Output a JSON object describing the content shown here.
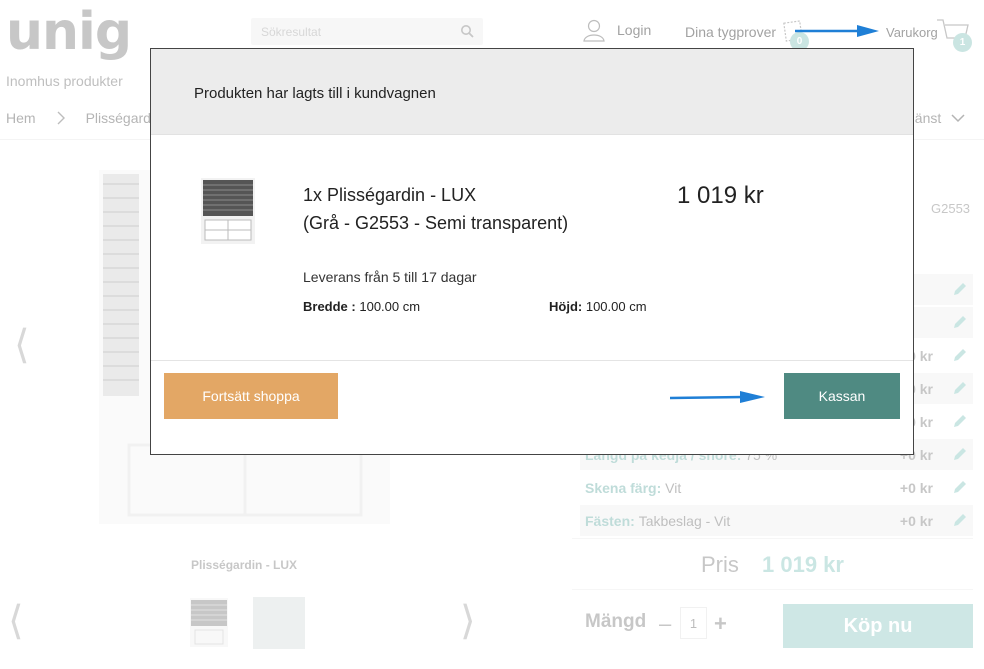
{
  "colors": {
    "accent": "#9fd2cd",
    "checkout": "#4f8a82",
    "continue": "#e3a765",
    "annotation_arrow": "#1f7fd6"
  },
  "header": {
    "logo": "unig",
    "search_placeholder": "Sökresultat",
    "login_label": "Login",
    "swatches_label": "Dina tygprover",
    "swatches_count": "0",
    "cart_label": "Varukorg",
    "cart_count": "1"
  },
  "subnav": {
    "label": "Inomhus produkter"
  },
  "breadcrumb": {
    "home": "Hem",
    "current": "Plisségardin",
    "right_menu": "dtjänst"
  },
  "product": {
    "caption": "Plisségardin - LUX",
    "code": "G2553"
  },
  "options": [
    {
      "label": "",
      "value": "",
      "price": ""
    },
    {
      "label": "",
      "value": "",
      "price": ""
    },
    {
      "label": "",
      "value": "",
      "price": "0 kr"
    },
    {
      "label": "",
      "value": "",
      "price": "0 kr"
    },
    {
      "label": "",
      "value": "",
      "price": "0 kr"
    },
    {
      "label": "Längd på kedja / snöre:",
      "value": "75 %",
      "price": "+0 kr"
    },
    {
      "label": "Skena färg:",
      "value": "Vit",
      "price": "+0 kr"
    },
    {
      "label": "Fästen:",
      "value": "Takbeslag - Vit",
      "price": "+0 kr"
    }
  ],
  "purchase": {
    "price_label": "Pris",
    "price_value": "1 019 kr",
    "qty_label": "Mängd",
    "qty_minus": "–",
    "qty_value": "1",
    "qty_plus": "+",
    "buy_label": "Köp nu"
  },
  "modal": {
    "title": "Produkten har lagts till i kundvagnen",
    "item_line1": "1x Plisségardin - LUX",
    "item_line2": "(Grå - G2553 - Semi transparent)",
    "item_price": "1 019 kr",
    "delivery": "Leverans från 5 till 17 dagar",
    "width_label": "Bredde :",
    "width_value": "100.00 cm",
    "height_label": "Höjd:",
    "height_value": "100.00 cm",
    "continue_label": "Fortsätt shoppa",
    "checkout_label": "Kassan"
  }
}
